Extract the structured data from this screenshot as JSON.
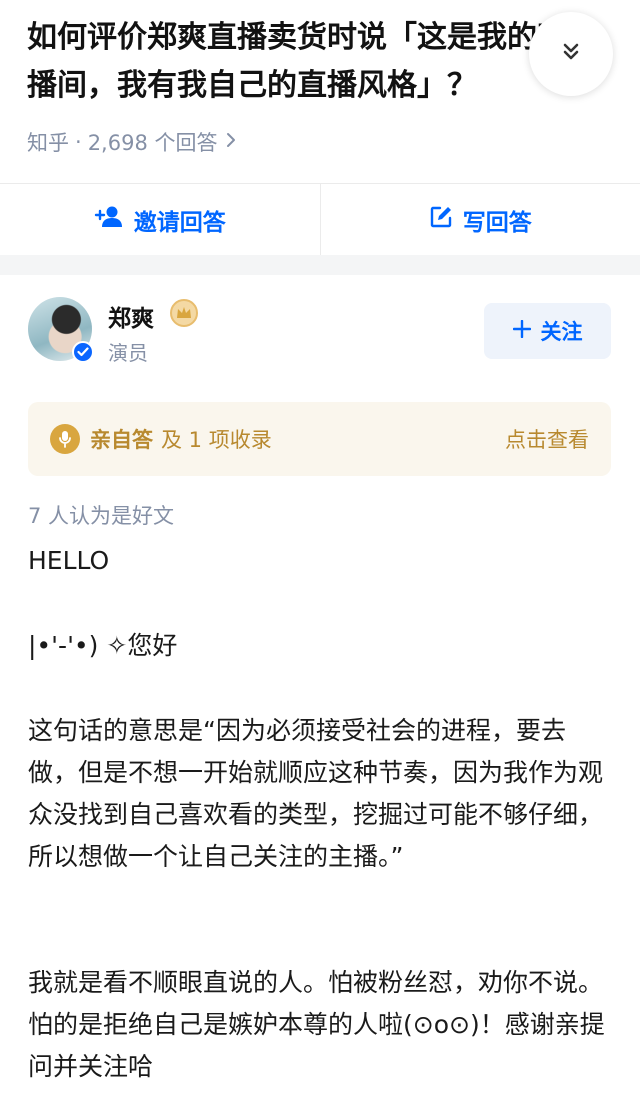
{
  "question": {
    "title": "如何评价郑爽直播卖货时说「这是我的直播间，我有我自己的直播风格」？",
    "source": "知乎",
    "separator": "·",
    "answer_count": "2,698 个回答"
  },
  "actions": {
    "invite_label": "邀请回答",
    "write_label": "写回答"
  },
  "author": {
    "name": "郑爽",
    "role": "演员",
    "follow_label": "关注"
  },
  "self_answer": {
    "strong": "亲自答",
    "rest": "及 1 项收录",
    "view_label": "点击查看"
  },
  "likes_text": "7 人认为是好文",
  "content": {
    "p1": "HELLO",
    "p2": "|•'-'•) ✧您好",
    "p3": "这句话的意思是“因为必须接受社会的进程，要去做，但是不想一开始就顺应这种节奏，因为我作为观众没找到自己喜欢看的类型，挖掘过可能不够仔细，所以想做一个让自己关注的主播。”",
    "p4": "我就是看不顺眼直说的人。怕被粉丝怼，劝你不说。怕的是拒绝自己是嫉妒本尊的人啦(⊙o⊙)！感谢亲提问并关注哈"
  },
  "colors": {
    "brand_blue": "#0066ff",
    "muted": "#8590a6",
    "gold": "#b8892f"
  }
}
